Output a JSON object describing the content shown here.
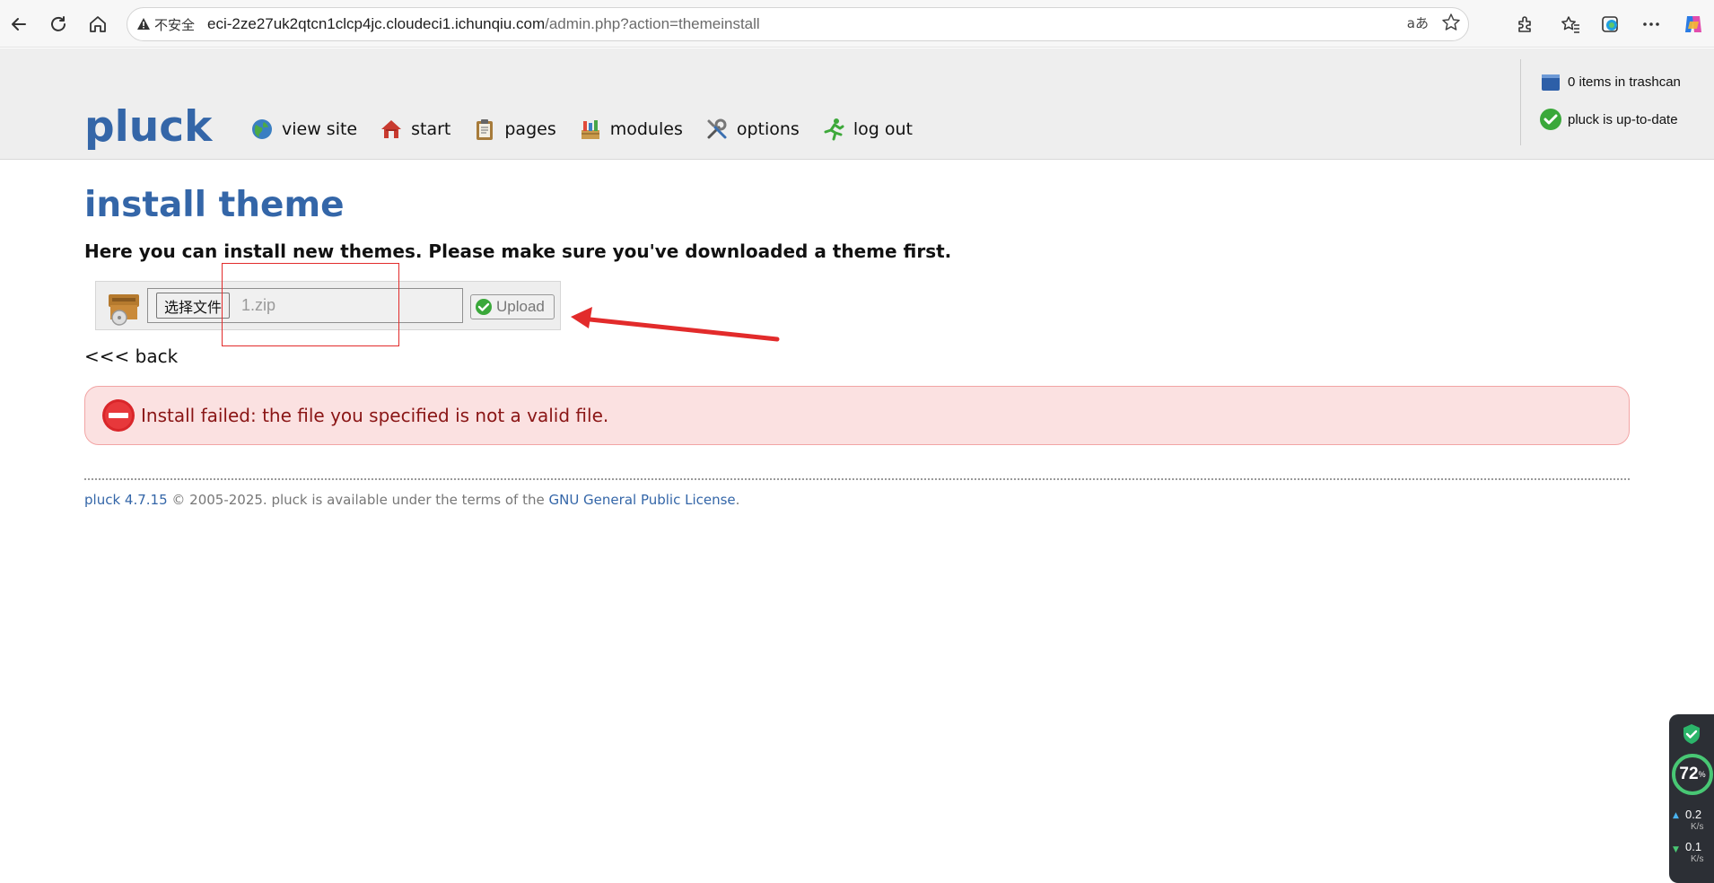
{
  "browser": {
    "security_label": "不安全",
    "url_host": "eci-2ze27uk2qtcn1clcp4jc.cloudeci1.ichunqiu.com",
    "url_path": "/admin.php?action=themeinstall"
  },
  "header": {
    "logo": "pluck",
    "menu": [
      {
        "label": "view site",
        "icon": "globe-icon"
      },
      {
        "label": "start",
        "icon": "home-icon"
      },
      {
        "label": "pages",
        "icon": "clipboard-icon"
      },
      {
        "label": "modules",
        "icon": "modules-icon"
      },
      {
        "label": "options",
        "icon": "tools-icon"
      },
      {
        "label": "log out",
        "icon": "running-man-icon"
      }
    ],
    "trashcan_text": "0 items in trashcan",
    "update_text": "pluck is up-to-date"
  },
  "main": {
    "title": "install theme",
    "intro": "Here you can install new themes. Please make sure you've downloaded a theme first.",
    "choose_file_label": "选择文件",
    "file_name": "1.zip",
    "upload_label": "Upload",
    "back_label": "<<< back",
    "error_message": "Install failed: the file you specified is not a valid file."
  },
  "footer": {
    "version_link": "pluck 4.7.15",
    "middle_text": " © 2005-2025. pluck is available under the terms of the ",
    "license_link": "GNU General Public License",
    "end_text": "."
  },
  "widget": {
    "percent": "72",
    "percent_sign": "%",
    "up_speed": "0.2",
    "down_speed": "0.1",
    "unit": "K/s"
  },
  "colors": {
    "brand_blue": "#3466a8",
    "error_bg": "#fbe1e1",
    "error_text": "#8a1515",
    "annotation_red": "#e22b2b"
  }
}
